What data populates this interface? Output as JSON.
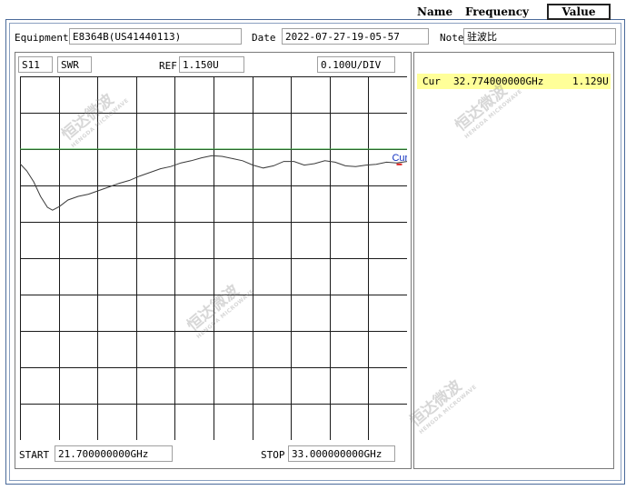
{
  "header": {
    "equipment_label": "Equipment",
    "equipment_value": "E8364B(US41440113)",
    "date_label": "Date",
    "date_value": "2022-07-27-19-05-57",
    "note_label": "Note",
    "note_value": "驻波比"
  },
  "plot_header": {
    "param": "S11",
    "format": "SWR",
    "ref_label": "REF",
    "ref_value": "1.150U",
    "scale": "0.100U/DIV"
  },
  "plot_footer": {
    "start_label": "START",
    "start_value": "21.700000000GHz",
    "stop_label": "STOP",
    "stop_value": "33.000000000GHz"
  },
  "table": {
    "headers": [
      "Name",
      "Frequency",
      "Value"
    ],
    "rows": [
      {
        "name": "Cur",
        "frequency": "32.774000000GHz",
        "value": "1.129U"
      }
    ]
  },
  "watermark": {
    "text": "恒达微波",
    "sub": "HENGDA MICROWAVE"
  },
  "chart_data": {
    "type": "line",
    "xlim": [
      21.7,
      33.0
    ],
    "ylim": [
      0.75,
      1.25
    ],
    "reference_line": 1.15,
    "grid": true,
    "marker": {
      "label": "Cur",
      "x": 32.774,
      "y": 1.129
    },
    "series": [
      {
        "x": [
          21.7,
          21.9,
          22.1,
          22.3,
          22.5,
          22.65,
          22.85,
          23.1,
          23.4,
          23.7,
          24.0,
          24.3,
          24.6,
          24.9,
          25.2,
          25.5,
          25.8,
          26.1,
          26.4,
          26.7,
          27.0,
          27.3,
          27.6,
          27.9,
          28.2,
          28.5,
          28.8,
          29.1,
          29.4,
          29.7,
          30.0,
          30.3,
          30.6,
          30.9,
          31.2,
          31.5,
          31.8,
          32.1,
          32.4,
          32.7,
          33.0
        ],
        "y": [
          1.13,
          1.12,
          1.105,
          1.085,
          1.07,
          1.066,
          1.071,
          1.08,
          1.085,
          1.088,
          1.093,
          1.098,
          1.103,
          1.107,
          1.113,
          1.118,
          1.123,
          1.126,
          1.131,
          1.134,
          1.138,
          1.141,
          1.14,
          1.137,
          1.134,
          1.128,
          1.124,
          1.127,
          1.133,
          1.133,
          1.128,
          1.13,
          1.134,
          1.132,
          1.127,
          1.126,
          1.128,
          1.129,
          1.132,
          1.131,
          1.133
        ]
      }
    ]
  }
}
